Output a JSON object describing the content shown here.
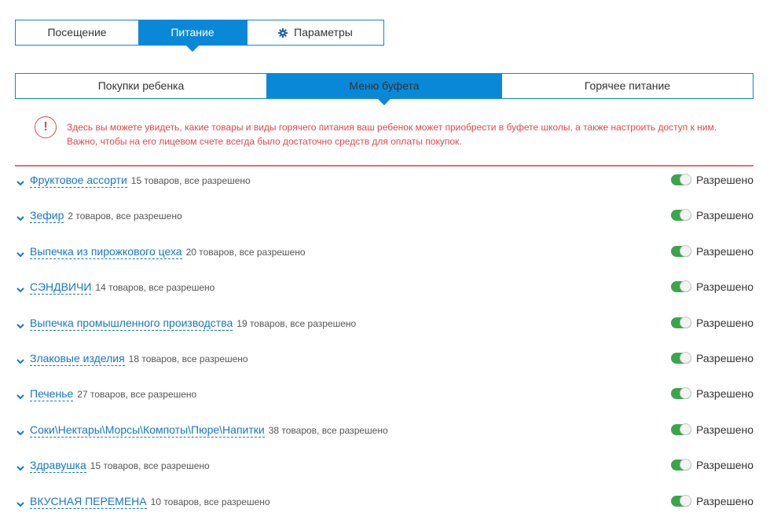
{
  "top_tabs": [
    {
      "label": "Посещение",
      "active": false
    },
    {
      "label": "Питание",
      "active": true
    },
    {
      "label": "Параметры",
      "active": false,
      "icon": "gear-icon"
    }
  ],
  "sub_tabs": [
    {
      "label": "Покупки ребенка",
      "active": false
    },
    {
      "label": "Меню буфета",
      "active": true
    },
    {
      "label": "Горячее питание",
      "active": false
    }
  ],
  "notice": {
    "icon": "!",
    "line1": "Здесь вы можете увидеть, какие товары и виды горячего питания ваш ребенок может приобрести в буфете школы, а также настроить доступ к ним.",
    "line2": "Важно, чтобы на его лицевом счете всегда было достаточно средств для оплаты покупок."
  },
  "categories": [
    {
      "name": "Фруктовое ассорти",
      "meta": "15 товаров, все разрешено",
      "status": "Разрешено"
    },
    {
      "name": "Зефир",
      "meta": "2 товаров, все разрешено",
      "status": "Разрешено"
    },
    {
      "name": "Выпечка из пирожкового цеха",
      "meta": "20 товаров, все разрешено",
      "status": "Разрешено"
    },
    {
      "name": "СЭНДВИЧИ",
      "meta": "14 товаров, все разрешено",
      "status": "Разрешено"
    },
    {
      "name": "Выпечка промышленного производства",
      "meta": "19 товаров, все разрешено",
      "status": "Разрешено"
    },
    {
      "name": "Злаковые изделия",
      "meta": "18 товаров, все разрешено",
      "status": "Разрешено"
    },
    {
      "name": "Печенье",
      "meta": "27 товаров, все разрешено",
      "status": "Разрешено"
    },
    {
      "name": "Соки\\Нектары\\Морсы\\Компоты\\Пюре\\Напитки",
      "meta": "38 товаров, все разрешено",
      "status": "Разрешено"
    },
    {
      "name": "Здравушка",
      "meta": "15 товаров, все разрешено",
      "status": "Разрешено"
    },
    {
      "name": "ВКУСНАЯ ПЕРЕМЕНА",
      "meta": "10 товаров, все разрешено",
      "status": "Разрешено"
    }
  ],
  "colors": {
    "accent": "#0a88d8",
    "link": "#1676c9",
    "warning": "#e8454a",
    "toggle_on": "#3aa54b"
  }
}
